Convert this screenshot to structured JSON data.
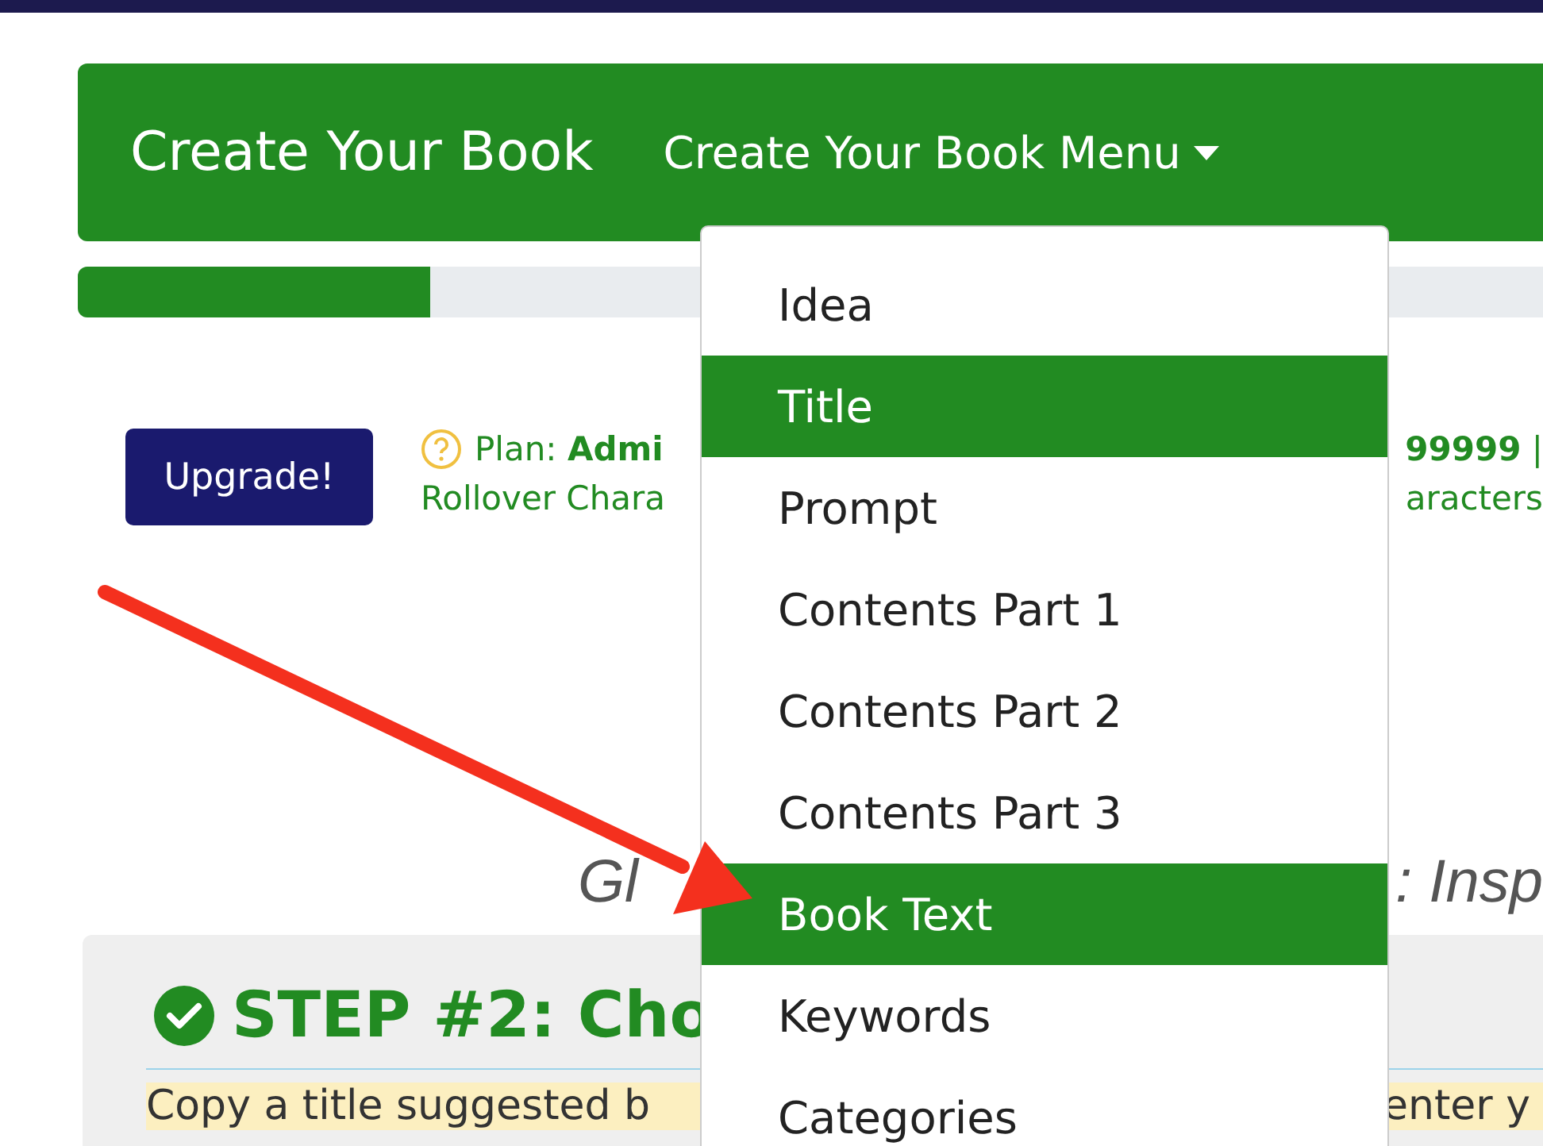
{
  "navbar": {
    "brand": "Create Your Book",
    "menu_toggle": "Create Your Book Menu"
  },
  "progress": {
    "level": 0.24
  },
  "upgrade_button": "Upgrade!",
  "plan_line": {
    "left": "Plan: **Admi**",
    "right": "**99999** |"
  },
  "rollover_line": {
    "left": "Rollover Chara",
    "right": "aracters"
  },
  "heading": {
    "left": "Gl",
    "right": ": Insp"
  },
  "step": {
    "title": "STEP #2: Cho",
    "completed": true,
    "instruction_left": "Copy a title suggested b",
    "instruction_right": "enter y"
  },
  "dropdown": {
    "items": [
      {
        "label": "Idea",
        "selected": false
      },
      {
        "label": "Title",
        "selected": true
      },
      {
        "label": "Prompt",
        "selected": false
      },
      {
        "label": "Contents Part 1",
        "selected": false
      },
      {
        "label": "Contents Part 2",
        "selected": false
      },
      {
        "label": "Contents Part 3",
        "selected": false
      },
      {
        "label": "Book Text",
        "selected": true
      },
      {
        "label": "Keywords",
        "selected": false
      },
      {
        "label": "Categories",
        "selected": false
      }
    ]
  }
}
